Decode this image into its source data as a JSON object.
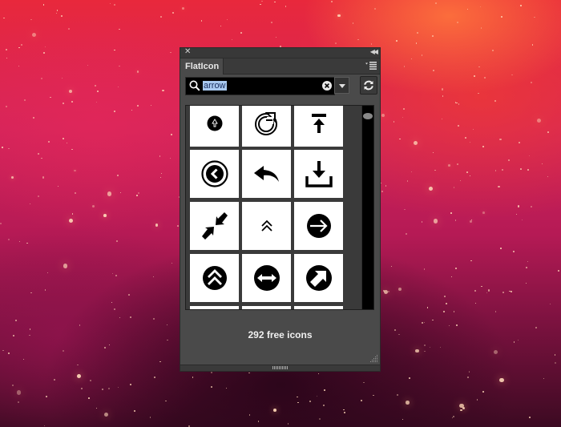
{
  "panel": {
    "title": "FlatIcon",
    "close_icon": "close-icon",
    "collapse_icon": "double-chevron-left-icon",
    "menu_icon": "panel-menu-icon"
  },
  "search": {
    "value": "arrow",
    "placeholder": "",
    "selection_color": "#a9c9ef"
  },
  "results": {
    "count_label": "292 free icons",
    "icons": [
      {
        "name": "circle-up-arrow-outline"
      },
      {
        "name": "refresh-circular-arrow"
      },
      {
        "name": "upload-to-top"
      },
      {
        "name": "circle-chevron-left"
      },
      {
        "name": "reply-arrow"
      },
      {
        "name": "download-tray"
      },
      {
        "name": "collapse-arrows"
      },
      {
        "name": "double-chevron-up"
      },
      {
        "name": "circle-arrow-right"
      },
      {
        "name": "circle-double-chevron-up"
      },
      {
        "name": "circle-left-right-arrow"
      },
      {
        "name": "circle-arrow-up-right"
      }
    ]
  },
  "colors": {
    "panel_bg": "#4a4a4a",
    "tile_bg": "#ffffff",
    "icon_fill": "#000000"
  }
}
